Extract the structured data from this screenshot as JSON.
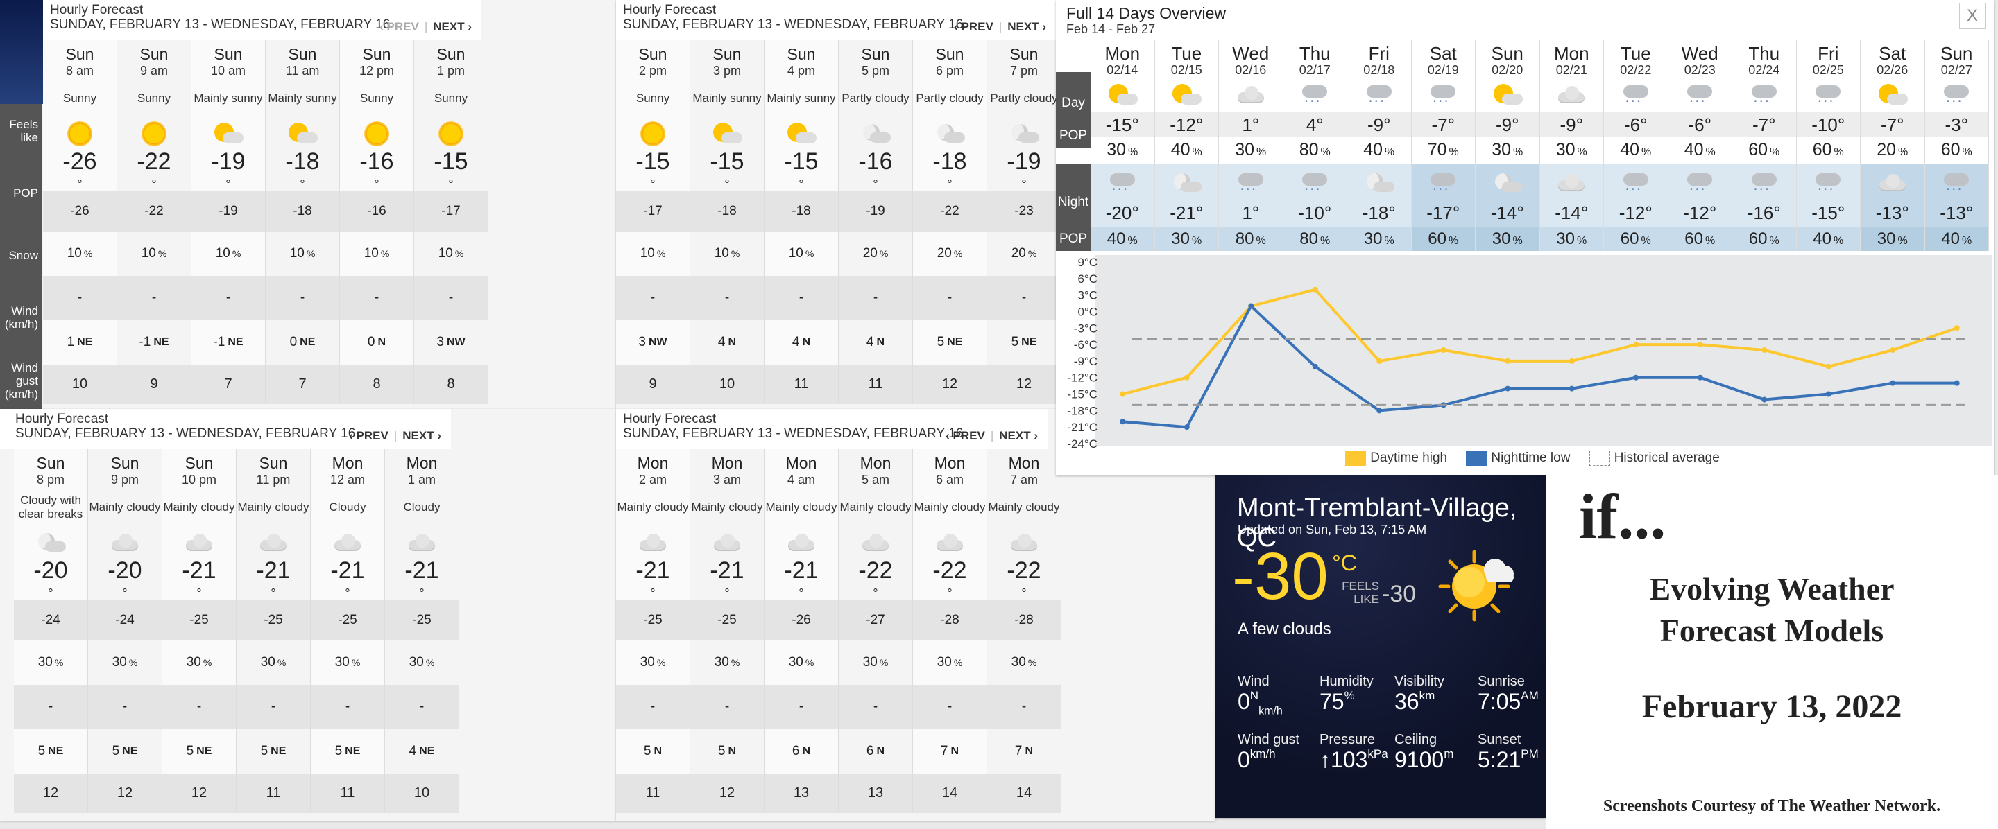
{
  "hourly_panels": [
    {
      "title": "Hourly Forecast",
      "range": "SUNDAY, FEBRUARY 13 - WEDNESDAY, FEBRUARY 16",
      "prev": "‹ PREV",
      "next": "NEXT ›",
      "labels": {
        "feels": "Feels like",
        "pop": "POP",
        "snow": "Snow",
        "wind": "Wind (km/h)",
        "gust": "Wind gust (km/h)"
      },
      "hours": [
        {
          "day": "Sun",
          "time": "8 am",
          "cond": "Sunny",
          "icon": "sun",
          "temp": "-26",
          "feels": "-26",
          "pop": "10",
          "snow": "-",
          "wind": "1",
          "dir": "NE",
          "gust": "10"
        },
        {
          "day": "Sun",
          "time": "9 am",
          "cond": "Sunny",
          "icon": "sun",
          "temp": "-22",
          "feels": "-22",
          "pop": "10",
          "snow": "-",
          "wind": "-1",
          "dir": "NE",
          "gust": "9"
        },
        {
          "day": "Sun",
          "time": "10 am",
          "cond": "Mainly sunny",
          "icon": "psun",
          "temp": "-19",
          "feels": "-19",
          "pop": "10",
          "snow": "-",
          "wind": "-1",
          "dir": "NE",
          "gust": "7"
        },
        {
          "day": "Sun",
          "time": "11 am",
          "cond": "Mainly sunny",
          "icon": "psun",
          "temp": "-18",
          "feels": "-18",
          "pop": "10",
          "snow": "-",
          "wind": "0",
          "dir": "NE",
          "gust": "7"
        },
        {
          "day": "Sun",
          "time": "12 pm",
          "cond": "Sunny",
          "icon": "sun",
          "temp": "-16",
          "feels": "-16",
          "pop": "10",
          "snow": "-",
          "wind": "0",
          "dir": "N",
          "gust": "8"
        },
        {
          "day": "Sun",
          "time": "1 pm",
          "cond": "Sunny",
          "icon": "sun",
          "temp": "-15",
          "feels": "-17",
          "pop": "10",
          "snow": "-",
          "wind": "3",
          "dir": "NW",
          "gust": "8"
        }
      ]
    },
    {
      "title": "Hourly Forecast",
      "range": "SUNDAY, FEBRUARY 13 - WEDNESDAY, FEBRUARY 16",
      "prev": "‹ PREV",
      "next": "NEXT ›",
      "hours": [
        {
          "day": "Sun",
          "time": "2 pm",
          "cond": "Sunny",
          "icon": "sun",
          "temp": "-15",
          "feels": "-17",
          "pop": "10",
          "snow": "-",
          "wind": "3",
          "dir": "NW",
          "gust": "9"
        },
        {
          "day": "Sun",
          "time": "3 pm",
          "cond": "Mainly sunny",
          "icon": "psun",
          "temp": "-15",
          "feels": "-18",
          "pop": "10",
          "snow": "-",
          "wind": "4",
          "dir": "N",
          "gust": "10"
        },
        {
          "day": "Sun",
          "time": "4 pm",
          "cond": "Mainly sunny",
          "icon": "psun",
          "temp": "-15",
          "feels": "-18",
          "pop": "10",
          "snow": "-",
          "wind": "4",
          "dir": "N",
          "gust": "11"
        },
        {
          "day": "Sun",
          "time": "5 pm",
          "cond": "Partly cloudy",
          "icon": "pmoon",
          "temp": "-16",
          "feels": "-19",
          "pop": "20",
          "snow": "-",
          "wind": "4",
          "dir": "N",
          "gust": "11"
        },
        {
          "day": "Sun",
          "time": "6 pm",
          "cond": "Partly cloudy",
          "icon": "pmoon",
          "temp": "-18",
          "feels": "-22",
          "pop": "20",
          "snow": "-",
          "wind": "5",
          "dir": "NE",
          "gust": "12"
        },
        {
          "day": "Sun",
          "time": "7 pm",
          "cond": "Partly cloudy",
          "icon": "pmoon",
          "temp": "-19",
          "feels": "-23",
          "pop": "20",
          "snow": "-",
          "wind": "5",
          "dir": "NE",
          "gust": "12"
        }
      ]
    },
    {
      "title": "Hourly Forecast",
      "range": "SUNDAY, FEBRUARY 13 - WEDNESDAY, FEBRUARY 16",
      "prev": "‹ PREV",
      "next": "NEXT ›",
      "hours": [
        {
          "day": "Sun",
          "time": "8 pm",
          "cond": "Cloudy with clear breaks",
          "icon": "pmoon",
          "temp": "-20",
          "feels": "-24",
          "pop": "30",
          "snow": "-",
          "wind": "5",
          "dir": "NE",
          "gust": "12"
        },
        {
          "day": "Sun",
          "time": "9 pm",
          "cond": "Mainly cloudy",
          "icon": "cloud",
          "temp": "-20",
          "feels": "-24",
          "pop": "30",
          "snow": "-",
          "wind": "5",
          "dir": "NE",
          "gust": "12"
        },
        {
          "day": "Sun",
          "time": "10 pm",
          "cond": "Mainly cloudy",
          "icon": "cloud",
          "temp": "-21",
          "feels": "-25",
          "pop": "30",
          "snow": "-",
          "wind": "5",
          "dir": "NE",
          "gust": "12"
        },
        {
          "day": "Sun",
          "time": "11 pm",
          "cond": "Mainly cloudy",
          "icon": "cloud",
          "temp": "-21",
          "feels": "-25",
          "pop": "30",
          "snow": "-",
          "wind": "5",
          "dir": "NE",
          "gust": "11"
        },
        {
          "day": "Mon",
          "time": "12 am",
          "cond": "Cloudy",
          "icon": "cloud",
          "temp": "-21",
          "feels": "-25",
          "pop": "30",
          "snow": "-",
          "wind": "5",
          "dir": "NE",
          "gust": "11"
        },
        {
          "day": "Mon",
          "time": "1 am",
          "cond": "Cloudy",
          "icon": "cloud",
          "temp": "-21",
          "feels": "-25",
          "pop": "30",
          "snow": "-",
          "wind": "4",
          "dir": "NE",
          "gust": "10"
        }
      ]
    },
    {
      "title": "Hourly Forecast",
      "range": "SUNDAY, FEBRUARY 13 - WEDNESDAY, FEBRUARY 16",
      "prev": "‹ PREV",
      "next": "NEXT ›",
      "hours": [
        {
          "day": "Mon",
          "time": "2 am",
          "cond": "Mainly cloudy",
          "icon": "cloud",
          "temp": "-21",
          "feels": "-25",
          "pop": "30",
          "snow": "-",
          "wind": "5",
          "dir": "N",
          "gust": "11"
        },
        {
          "day": "Mon",
          "time": "3 am",
          "cond": "Mainly cloudy",
          "icon": "cloud",
          "temp": "-21",
          "feels": "-25",
          "pop": "30",
          "snow": "-",
          "wind": "5",
          "dir": "N",
          "gust": "12"
        },
        {
          "day": "Mon",
          "time": "4 am",
          "cond": "Mainly cloudy",
          "icon": "cloud",
          "temp": "-21",
          "feels": "-26",
          "pop": "30",
          "snow": "-",
          "wind": "6",
          "dir": "N",
          "gust": "13"
        },
        {
          "day": "Mon",
          "time": "5 am",
          "cond": "Mainly cloudy",
          "icon": "cloud",
          "temp": "-22",
          "feels": "-27",
          "pop": "30",
          "snow": "-",
          "wind": "6",
          "dir": "N",
          "gust": "13"
        },
        {
          "day": "Mon",
          "time": "6 am",
          "cond": "Mainly cloudy",
          "icon": "cloud",
          "temp": "-22",
          "feels": "-28",
          "pop": "30",
          "snow": "-",
          "wind": "7",
          "dir": "N",
          "gust": "14"
        },
        {
          "day": "Mon",
          "time": "7 am",
          "cond": "Mainly cloudy",
          "icon": "cloud",
          "temp": "-22",
          "feels": "-28",
          "pop": "30",
          "snow": "-",
          "wind": "7",
          "dir": "N",
          "gust": "14"
        }
      ]
    }
  ],
  "overview": {
    "title": "Full 14 Days Overview",
    "subtitle": "Feb 14 - Feb 27",
    "close": "X",
    "labels": {
      "day": "Day",
      "pop": "POP",
      "night": "Night",
      "npop": "POP"
    },
    "days": [
      {
        "day": "Mon",
        "date": "02/14",
        "dicon": "psun",
        "dt": "-15",
        "dp": "30",
        "nicon": "snowc",
        "nt": "-20",
        "np": "40"
      },
      {
        "day": "Tue",
        "date": "02/15",
        "dicon": "psun",
        "dt": "-12",
        "dp": "40",
        "nicon": "pmoon",
        "nt": "-21",
        "np": "30"
      },
      {
        "day": "Wed",
        "date": "02/16",
        "dicon": "cloud",
        "dt": "1",
        "dp": "30",
        "nicon": "snowc",
        "nt": "1",
        "np": "80"
      },
      {
        "day": "Thu",
        "date": "02/17",
        "dicon": "snowc",
        "dt": "4",
        "dp": "80",
        "nicon": "snowc",
        "nt": "-10",
        "np": "80"
      },
      {
        "day": "Fri",
        "date": "02/18",
        "dicon": "snowc",
        "dt": "-9",
        "dp": "40",
        "nicon": "pmoon",
        "nt": "-18",
        "np": "30"
      },
      {
        "day": "Sat",
        "date": "02/19",
        "dicon": "snowc",
        "dt": "-7",
        "dp": "70",
        "nicon": "snowc",
        "nt": "-17",
        "np": "60",
        "wk": true
      },
      {
        "day": "Sun",
        "date": "02/20",
        "dicon": "psun",
        "dt": "-9",
        "dp": "30",
        "nicon": "pmoon",
        "nt": "-14",
        "np": "30",
        "wk": true
      },
      {
        "day": "Mon",
        "date": "02/21",
        "dicon": "cloud",
        "dt": "-9",
        "dp": "30",
        "nicon": "cloud",
        "nt": "-14",
        "np": "30"
      },
      {
        "day": "Tue",
        "date": "02/22",
        "dicon": "snowc",
        "dt": "-6",
        "dp": "40",
        "nicon": "snowc",
        "nt": "-12",
        "np": "60"
      },
      {
        "day": "Wed",
        "date": "02/23",
        "dicon": "snowc",
        "dt": "-6",
        "dp": "40",
        "nicon": "snowc",
        "nt": "-12",
        "np": "60"
      },
      {
        "day": "Thu",
        "date": "02/24",
        "dicon": "snowc",
        "dt": "-7",
        "dp": "60",
        "nicon": "snowc",
        "nt": "-16",
        "np": "60"
      },
      {
        "day": "Fri",
        "date": "02/25",
        "dicon": "snowc",
        "dt": "-10",
        "dp": "60",
        "nicon": "snowc",
        "nt": "-15",
        "np": "40"
      },
      {
        "day": "Sat",
        "date": "02/26",
        "dicon": "psun",
        "dt": "-7",
        "dp": "20",
        "nicon": "cloud",
        "nt": "-13",
        "np": "30",
        "wk": true
      },
      {
        "day": "Sun",
        "date": "02/27",
        "dicon": "snowc",
        "dt": "-3",
        "dp": "60",
        "nicon": "snowc",
        "nt": "-13",
        "np": "40",
        "wk": true
      }
    ]
  },
  "chart_data": {
    "type": "line",
    "x": [
      "02/14",
      "02/15",
      "02/16",
      "02/17",
      "02/18",
      "02/19",
      "02/20",
      "02/21",
      "02/22",
      "02/23",
      "02/24",
      "02/25",
      "02/26",
      "02/27"
    ],
    "series": [
      {
        "name": "Daytime high",
        "color": "#fdc82f",
        "values": [
          -15,
          -12,
          1,
          4,
          -9,
          -7,
          -9,
          -9,
          -6,
          -6,
          -7,
          -10,
          -7,
          -3
        ]
      },
      {
        "name": "Nighttime low",
        "color": "#3a72b8",
        "values": [
          -20,
          -21,
          1,
          -10,
          -18,
          -17,
          -14,
          -14,
          -12,
          -12,
          -16,
          -15,
          -13,
          -13
        ]
      },
      {
        "name": "Historical average",
        "color": "#999999",
        "values": [
          -5,
          -5,
          -5,
          -5,
          -5,
          -5,
          -5,
          -5,
          -5,
          -5,
          -5,
          -5,
          -5,
          -5
        ]
      },
      {
        "name": "Historical average low",
        "color": "#999999",
        "values": [
          -17,
          -17,
          -17,
          -17,
          -17,
          -17,
          -17,
          -17,
          -17,
          -17,
          -17,
          -17,
          -17,
          -17
        ]
      }
    ],
    "legend": [
      "Daytime high",
      "Nighttime low",
      "Historical average"
    ],
    "yticks": [
      "9°C",
      "6°C",
      "3°C",
      "0°C",
      "-3°C",
      "-6°C",
      "-9°C",
      "-12°C",
      "-15°C",
      "-18°C",
      "-21°C",
      "-24°C"
    ],
    "ylim": [
      -24,
      9
    ],
    "grid": false
  },
  "current": {
    "location": "Mont-Tremblant-Village, QC",
    "updated": "Updated on Sun, Feb 13, 7:15 AM",
    "temp": "-30",
    "unit": "°C",
    "feels_label": "FEELS LIKE",
    "feels": "-30",
    "condition": "A few clouds",
    "metrics": [
      {
        "label": "Wind",
        "value": "0",
        "sup": "N",
        "sub": "km/h"
      },
      {
        "label": "Humidity",
        "value": "75",
        "sup": "%",
        "sub": ""
      },
      {
        "label": "Visibility",
        "value": "36",
        "sup": "km",
        "sub": ""
      },
      {
        "label": "Sunrise",
        "value": "7:05",
        "sup": "AM",
        "sub": ""
      },
      {
        "label": "Wind gust",
        "value": "0",
        "sup": "km/h",
        "sub": ""
      },
      {
        "label": "Pressure",
        "value": "↑103",
        "sup": "kPa",
        "sub": ""
      },
      {
        "label": "Ceiling",
        "value": "9100",
        "sup": "m",
        "sub": ""
      },
      {
        "label": "Sunset",
        "value": "5:21",
        "sup": "PM",
        "sub": ""
      }
    ]
  },
  "title_card": {
    "if": "if...",
    "line1": "Evolving Weather",
    "line2": "Forecast Models",
    "date": "February 13, 2022",
    "credit": "Screenshots Courtesy of The Weather Network."
  }
}
